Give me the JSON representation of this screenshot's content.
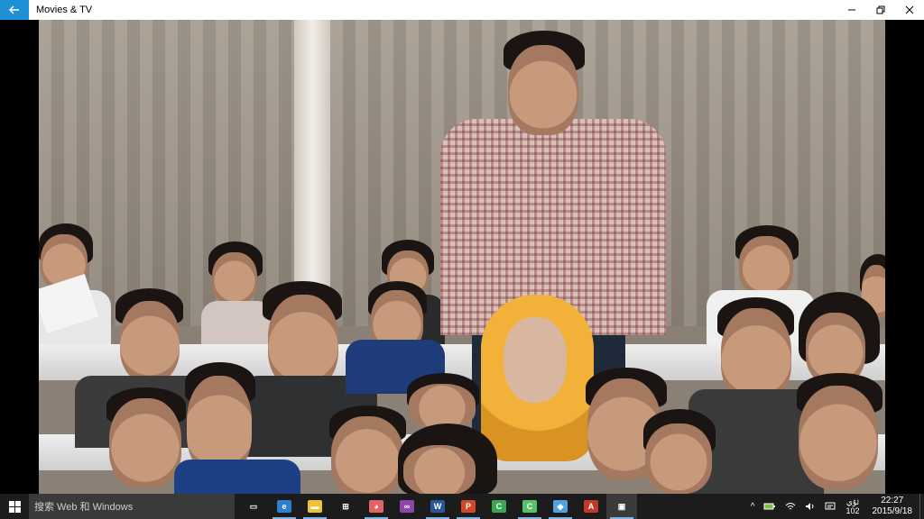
{
  "window": {
    "title": "Movies & TV",
    "back_icon": "back-arrow-icon",
    "minimize_icon": "minimize-icon",
    "restore_icon": "restore-icon",
    "close_icon": "close-icon"
  },
  "colors": {
    "accent": "#1e90d6",
    "taskbar": "#1c1c1c",
    "search_bg": "#3a3a3a"
  },
  "taskbar": {
    "search_placeholder": "搜索 Web 和 Windows",
    "pinned": [
      {
        "name": "task-view",
        "icon": "task-view-icon",
        "glyph": "▭"
      },
      {
        "name": "edge",
        "icon": "edge-icon",
        "glyph": "e",
        "color": "#2d7fd1",
        "active": true
      },
      {
        "name": "file-explorer",
        "icon": "folder-icon",
        "glyph": "▬",
        "color": "#f1c232",
        "active": true
      },
      {
        "name": "store",
        "icon": "store-icon",
        "glyph": "⊞",
        "color": "#ffffff"
      },
      {
        "name": "paint",
        "icon": "paint-icon",
        "glyph": "◕",
        "color": "#e06666",
        "active": true
      },
      {
        "name": "visual-studio",
        "icon": "visual-studio-icon",
        "glyph": "∞",
        "color": "#8e44ad"
      },
      {
        "name": "word",
        "icon": "word-icon",
        "glyph": "W",
        "color": "#2b579a",
        "active": true
      },
      {
        "name": "powerpoint",
        "icon": "powerpoint-icon",
        "glyph": "P",
        "color": "#d24726",
        "active": true
      },
      {
        "name": "camtasia",
        "icon": "camtasia-icon",
        "glyph": "C",
        "color": "#3aa655"
      },
      {
        "name": "camtasia-recorder",
        "icon": "camtasia-recorder-icon",
        "glyph": "C",
        "color": "#55c26a",
        "active": true
      },
      {
        "name": "app-blue",
        "icon": "app-icon",
        "glyph": "◆",
        "color": "#4fa3e0",
        "active": true
      },
      {
        "name": "acrobat",
        "icon": "pdf-icon",
        "glyph": "A",
        "color": "#c0392b"
      },
      {
        "name": "movies-tv",
        "icon": "clapper-icon",
        "glyph": "▣",
        "color": "#ffffff",
        "active": true,
        "focused": true
      }
    ]
  },
  "tray": {
    "chevron_icon": "chevron-up-icon",
    "tray_icons": [
      "battery-icon",
      "network-icon",
      "volume-icon",
      "notification-icon"
    ],
    "ime_line1": "ئۇي",
    "ime_line2": "102",
    "time": "22:27",
    "date": "2015/9/18"
  }
}
